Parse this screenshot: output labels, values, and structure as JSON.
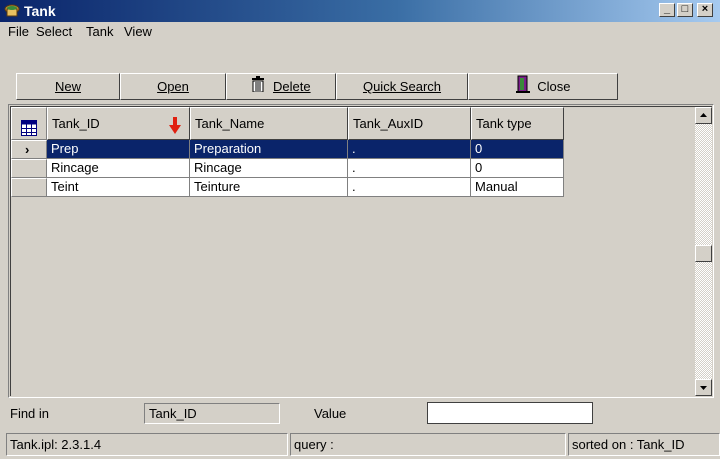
{
  "window": {
    "title": "Tank",
    "icon": "tank-app-icon",
    "controls": [
      "minimize",
      "maximize",
      "close"
    ],
    "control_glyphs": {
      "minimize": "_",
      "maximize": "□",
      "close": "×"
    }
  },
  "menu": {
    "items": [
      "File",
      "Select",
      "Tank",
      "View"
    ]
  },
  "toolbar": {
    "new_label": "New",
    "open_label": "Open",
    "delete_label": "Delete",
    "quick_search_label": "Quick Search",
    "close_label": "Close",
    "delete_icon": "trash-icon",
    "close_icon": "door-exit-icon"
  },
  "grid": {
    "columns": [
      "Tank_ID",
      "Tank_Name",
      "Tank_AuxID",
      "Tank type"
    ],
    "sort_indicator_icon": "sort-down-arrow-icon",
    "header_icon": "table-icon",
    "selected_row_marker": "›",
    "rows": [
      {
        "Tank_ID": "Prep",
        "Tank_Name": "Preparation",
        "Tank_AuxID": ".",
        "Tank_type": "0",
        "selected": true
      },
      {
        "Tank_ID": "Rincage",
        "Tank_Name": "Rincage",
        "Tank_AuxID": ".",
        "Tank_type": "0",
        "selected": false
      },
      {
        "Tank_ID": "Teint",
        "Tank_Name": "Teinture",
        "Tank_AuxID": ".",
        "Tank_type": "Manual",
        "selected": false
      }
    ]
  },
  "find": {
    "find_in_label": "Find in",
    "find_in_value": "Tank_ID",
    "value_label": "Value",
    "value_input": ""
  },
  "status": {
    "version": "Tank.ipl: 2.3.1.4",
    "query": "query :",
    "sorted_on": "sorted on : Tank_ID"
  },
  "colors": {
    "selection": "#0a246a",
    "titlebar_start": "#0a246a",
    "titlebar_end": "#a6caf0",
    "sort_arrow": "#e02010",
    "close_icon": "#7a1e8a"
  }
}
